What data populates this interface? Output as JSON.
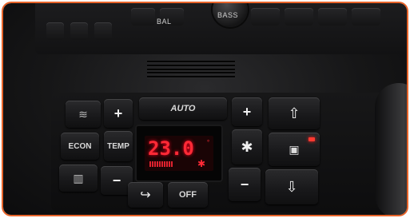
{
  "top_panel": {
    "bal_label": "BAL",
    "bass_label": "BASS"
  },
  "climate": {
    "auto_label": "AUTO",
    "econ_label": "ECON",
    "temp_label": "TEMP",
    "plus_label": "+",
    "minus_label": "−",
    "off_label": "OFF",
    "display_temp": "23.0",
    "display_unit": "°",
    "fan_symbol": "✱",
    "recirc_symbol": "↪",
    "up_symbol": "⇧",
    "down_symbol": "⇩",
    "center_symbol": "▣",
    "defrost_symbol": "≋",
    "rear_defrost_symbol": "▥"
  },
  "colors": {
    "display_red": "#ff2a36",
    "frame_accent": "#e8642a"
  }
}
